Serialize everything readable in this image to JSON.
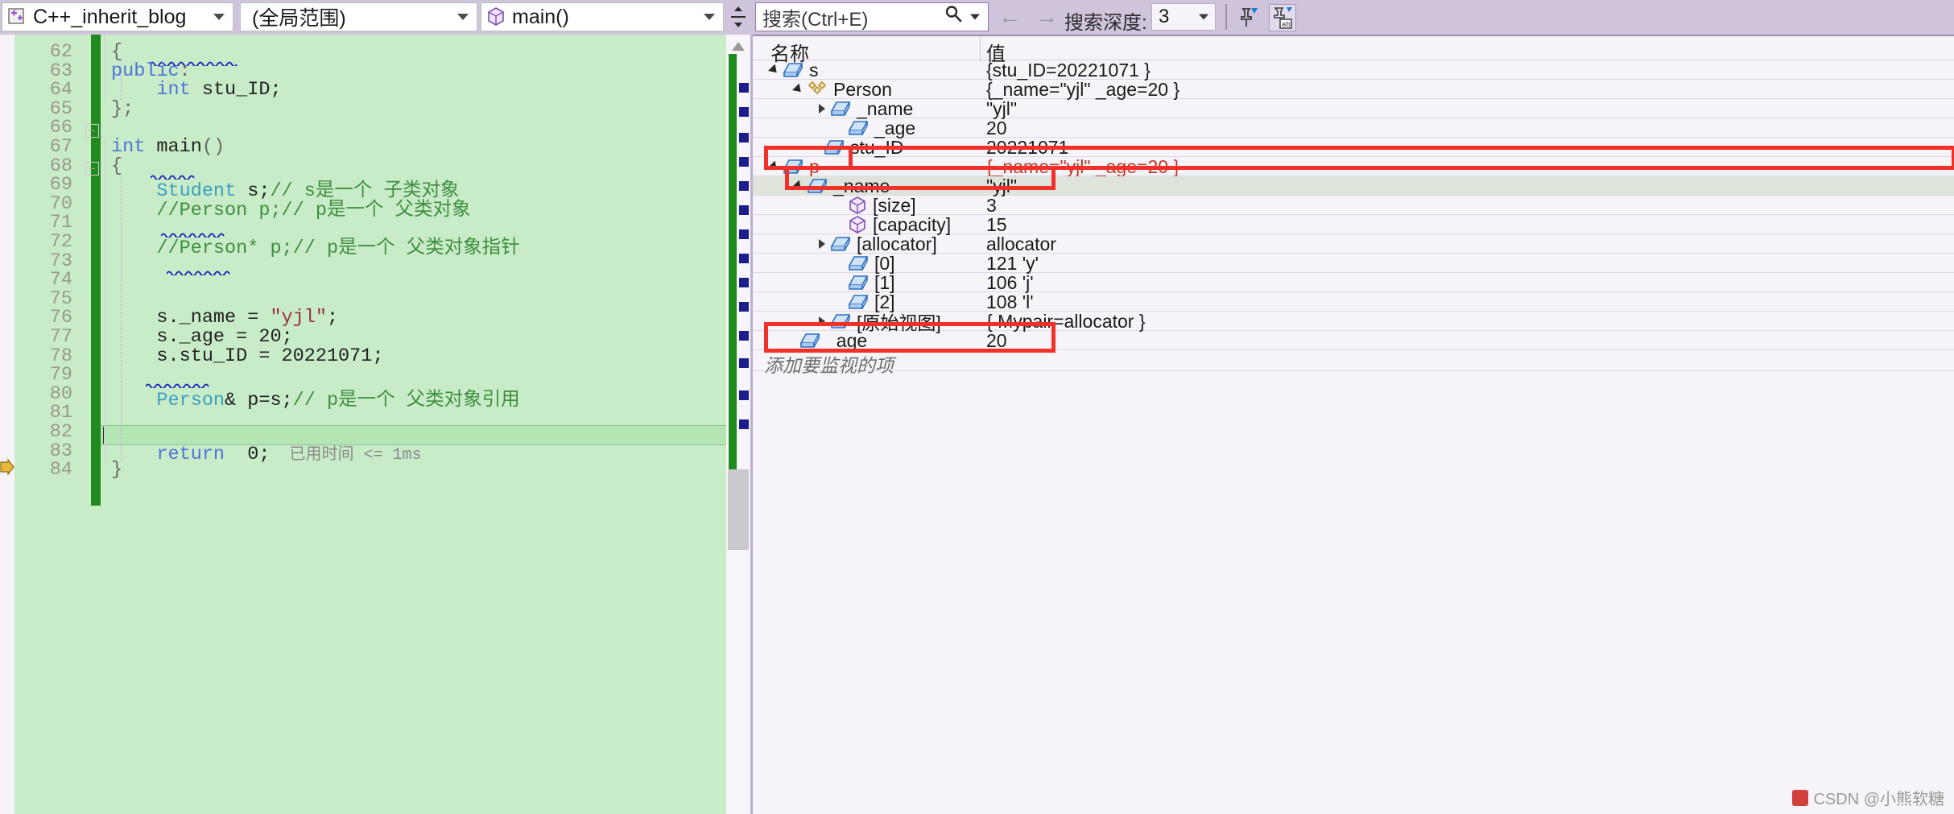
{
  "toolbar": {
    "project_combo": "C++_inherit_blog",
    "project_icon": "add-file-icon",
    "scope_combo": "(全局范围)",
    "function_combo": "main()",
    "function_icon": "method-cube-icon",
    "split_button": "split-view-icon",
    "search_placeholder": "搜索(Ctrl+E)",
    "search_icon": "search-icon",
    "search_dropdown_icon": "chevron-down-icon",
    "nav_back_icon": "arrow-left-icon",
    "nav_forward_icon": "arrow-right-icon",
    "depth_label": "搜索深度:",
    "depth_value": "3",
    "pin_icon": "pin-icon",
    "hex_icon": "hex-display-icon"
  },
  "editor": {
    "lines": [
      {
        "num": "62",
        "indent": 0,
        "segments": [
          {
            "t": "{",
            "c": "pn"
          }
        ]
      },
      {
        "num": "63",
        "indent": 0,
        "segments": [
          {
            "t": "public",
            "c": "k"
          },
          {
            "t": ":",
            "c": "pn"
          }
        ]
      },
      {
        "num": "64",
        "indent": 0,
        "segments": [
          {
            "t": "    ",
            "c": "id"
          },
          {
            "t": "int",
            "c": "k"
          },
          {
            "t": " stu_ID;",
            "c": "id"
          }
        ]
      },
      {
        "num": "65",
        "indent": 0,
        "segments": [
          {
            "t": "};",
            "c": "pn"
          }
        ]
      },
      {
        "num": "66",
        "indent": 0,
        "segments": []
      },
      {
        "num": "67",
        "indent": 0,
        "segments": [
          {
            "t": "int",
            "c": "k"
          },
          {
            "t": " ",
            "c": "id"
          },
          {
            "t": "main",
            "c": "nm"
          },
          {
            "t": "()",
            "c": "pn"
          }
        ]
      },
      {
        "num": "68",
        "indent": 0,
        "segments": [
          {
            "t": "{",
            "c": "pn"
          }
        ]
      },
      {
        "num": "69",
        "indent": 0,
        "segments": [
          {
            "t": "    ",
            "c": "id"
          },
          {
            "t": "Student",
            "c": "ty"
          },
          {
            "t": " s;",
            "c": "id"
          },
          {
            "t": "// s是一个 子类对象",
            "c": "cm"
          }
        ]
      },
      {
        "num": "70",
        "indent": 0,
        "segments": [
          {
            "t": "    ",
            "c": "id"
          },
          {
            "t": "//Person p;// p是一个 父类对象",
            "c": "cm"
          }
        ]
      },
      {
        "num": "71",
        "indent": 0,
        "segments": []
      },
      {
        "num": "72",
        "indent": 0,
        "segments": [
          {
            "t": "    ",
            "c": "id"
          },
          {
            "t": "//Person* p;// p是一个 父类对象指针",
            "c": "cm"
          }
        ]
      },
      {
        "num": "73",
        "indent": 0,
        "segments": []
      },
      {
        "num": "74",
        "indent": 0,
        "segments": []
      },
      {
        "num": "75",
        "indent": 0,
        "segments": []
      },
      {
        "num": "76",
        "indent": 0,
        "segments": [
          {
            "t": "    s._name = ",
            "c": "id"
          },
          {
            "t": "\"yjl\"",
            "c": "st"
          },
          {
            "t": ";",
            "c": "id"
          }
        ]
      },
      {
        "num": "77",
        "indent": 0,
        "segments": [
          {
            "t": "    s._age = ",
            "c": "id"
          },
          {
            "t": "20",
            "c": "id"
          },
          {
            "t": ";",
            "c": "id"
          }
        ]
      },
      {
        "num": "78",
        "indent": 0,
        "segments": [
          {
            "t": "    s.stu_ID = ",
            "c": "id"
          },
          {
            "t": "20221071",
            "c": "id"
          },
          {
            "t": ";",
            "c": "id"
          }
        ]
      },
      {
        "num": "79",
        "indent": 0,
        "segments": []
      },
      {
        "num": "80",
        "indent": 0,
        "segments": [
          {
            "t": "    ",
            "c": "id"
          },
          {
            "t": "Person",
            "c": "ty"
          },
          {
            "t": "& p=s;",
            "c": "id"
          },
          {
            "t": "// p是一个 父类对象引用",
            "c": "cm"
          }
        ]
      },
      {
        "num": "81",
        "indent": 0,
        "segments": []
      },
      {
        "num": "82",
        "indent": 0,
        "segments": []
      },
      {
        "num": "83",
        "indent": 0,
        "segments": [
          {
            "t": "    ",
            "c": "id"
          },
          {
            "t": "return",
            "c": "k"
          },
          {
            "t": "  ",
            "c": "id"
          },
          {
            "t": "0",
            "c": "id"
          },
          {
            "t": ";",
            "c": "id"
          }
        ],
        "hint": "已用时间 <= 1ms",
        "current": true
      },
      {
        "num": "84",
        "indent": 0,
        "segments": [
          {
            "t": "}",
            "c": "pn"
          }
        ]
      }
    ],
    "breakpoint_arrow_icon": "execution-pointer-icon",
    "scroll_up_icon": "scroll-up-arrow-icon"
  },
  "watch": {
    "col_name": "名称",
    "col_value": "值",
    "add_watch_placeholder": "添加要监视的项",
    "rows": [
      {
        "name": "s",
        "value": "{stu_ID=20221071 }",
        "depth": 0,
        "tri": "open",
        "icon": "variable-cube-icon",
        "highlight": false,
        "selected": false,
        "red": false
      },
      {
        "name": "Person",
        "value": "{_name=\"yjl\" _age=20 }",
        "depth": 1,
        "tri": "open",
        "icon": "base-class-icon",
        "highlight": false,
        "selected": false,
        "red": false
      },
      {
        "name": "_name",
        "value": "\"yjl\"",
        "depth": 2,
        "tri": "closed",
        "icon": "variable-cube-icon",
        "highlight": false,
        "selected": false,
        "red": false
      },
      {
        "name": "_age",
        "value": "20",
        "depth": 3,
        "tri": "none",
        "icon": "variable-cube-icon",
        "highlight": false,
        "selected": false,
        "red": false
      },
      {
        "name": "stu_ID",
        "value": "20221071",
        "depth": 2,
        "tri": "none",
        "icon": "variable-cube-icon",
        "highlight": false,
        "selected": false,
        "red": false
      },
      {
        "name": "p",
        "value": "{_name=\"yjl\" _age=20 }",
        "depth": 0,
        "tri": "open",
        "icon": "variable-cube-icon",
        "highlight": true,
        "selected": false,
        "red": true
      },
      {
        "name": "_name",
        "value": "\"yjl\"",
        "depth": 1,
        "tri": "open",
        "icon": "variable-cube-icon",
        "highlight": true,
        "selected": true,
        "red": false
      },
      {
        "name": "[size]",
        "value": "3",
        "depth": 3,
        "tri": "none",
        "icon": "property-cube-icon",
        "highlight": false,
        "selected": false,
        "red": false
      },
      {
        "name": "[capacity]",
        "value": "15",
        "depth": 3,
        "tri": "none",
        "icon": "property-cube-icon",
        "highlight": false,
        "selected": false,
        "red": false
      },
      {
        "name": "[allocator]",
        "value": "allocator",
        "depth": 2,
        "tri": "closed",
        "icon": "variable-cube-icon",
        "highlight": false,
        "selected": false,
        "red": false
      },
      {
        "name": "[0]",
        "value": "121 'y'",
        "depth": 3,
        "tri": "none",
        "icon": "variable-cube-icon",
        "highlight": false,
        "selected": false,
        "red": false
      },
      {
        "name": "[1]",
        "value": "106 'j'",
        "depth": 3,
        "tri": "none",
        "icon": "variable-cube-icon",
        "highlight": false,
        "selected": false,
        "red": false
      },
      {
        "name": "[2]",
        "value": "108 'l'",
        "depth": 3,
        "tri": "none",
        "icon": "variable-cube-icon",
        "highlight": false,
        "selected": false,
        "red": false
      },
      {
        "name": "[原始视图]",
        "value": "{ Mypair=allocator }",
        "depth": 2,
        "tri": "closed",
        "icon": "variable-cube-icon",
        "highlight": false,
        "selected": false,
        "red": false
      },
      {
        "name": "_age",
        "value": "20",
        "depth": 1,
        "tri": "none",
        "icon": "variable-cube-icon",
        "highlight": true,
        "selected": false,
        "red": false
      }
    ]
  },
  "watermark": {
    "text": "CSDN @小熊软糖"
  },
  "colors": {
    "toolbar_bg": "#cfc4db",
    "editor_bg": "#c8ebc8",
    "current_line": "#b4e6b4",
    "change_bar": "#1f8b1f",
    "red_box": "#f2302a",
    "comment": "#3f8f3f",
    "keyword": "#4f74d8",
    "type": "#3ea0c0",
    "string": "#9b3030",
    "watch_value_red": "#c0392b"
  }
}
